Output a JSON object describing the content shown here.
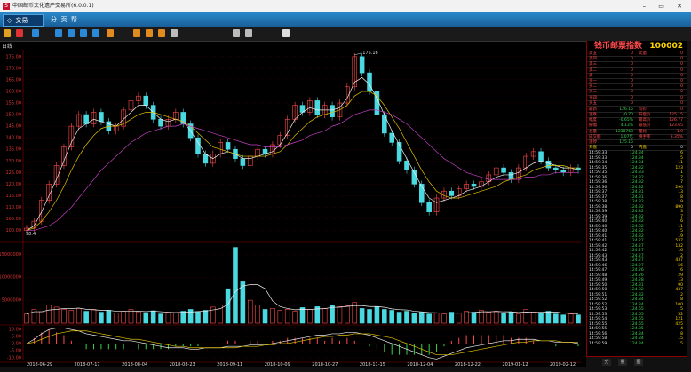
{
  "window": {
    "title": "中国邮币文化遗产交易所(6.0.0.1)",
    "logo": "S",
    "controls": "– ▭ ✕"
  },
  "menubar": {
    "trade_tab": "交易",
    "menu_items": [
      "分",
      "页",
      "帮"
    ]
  },
  "colors": {
    "up": "#ff4b4b",
    "down": "#38d24d",
    "accent": "#ffd700",
    "cyan": "#4ad9e0",
    "bg": "#000000"
  },
  "toolbar": {
    "icons": [
      "bar-chart-icon",
      "kline-icon",
      "minute-chart-icon",
      "fund-icon",
      "f10-icon",
      "f1-icon",
      "quote-icon",
      "ranking-icon",
      "f6-icon",
      "indicator-icon",
      "layout-icon",
      "draw-icon",
      "zoom-in-icon",
      "zoom-out-icon",
      "settings-icon"
    ]
  },
  "chart_data": {
    "type": "line",
    "period_label": "日线",
    "price_axis": {
      "ticks": [
        175,
        170,
        165,
        160,
        155,
        150,
        145,
        140,
        135,
        130,
        125,
        120,
        115,
        110,
        105,
        100
      ],
      "ylim": [
        96,
        178
      ]
    },
    "max_label": "175.16",
    "min_label": "98.4",
    "volume_axis": {
      "ticks": [
        15000000,
        10000000,
        5000000
      ],
      "tick_labels": [
        "15000000",
        "10000000",
        "5000000"
      ],
      "ylim": [
        0,
        17000000
      ]
    },
    "macd_axis": {
      "ticks": [
        10,
        5,
        0,
        -5,
        -10
      ],
      "tick_labels": [
        "10.00",
        "5.00",
        "0.00",
        "-5.00",
        "-10.00"
      ],
      "ylim": [
        -12,
        12
      ]
    },
    "date_labels": [
      "2018-06-29",
      "2018-07-17",
      "2018-08-04",
      "2018-08-23",
      "2018-09-11",
      "2018-10-09",
      "2018-10-27",
      "2018-11-15",
      "2018-12-04",
      "2018-12-22",
      "2019-01-12",
      "2019-02-12"
    ],
    "price_points": [
      101,
      104,
      113,
      120,
      128,
      136,
      145,
      150,
      146,
      151,
      147,
      143,
      145,
      152,
      156,
      158,
      154,
      148,
      145,
      148,
      151,
      146,
      140,
      133,
      129,
      133,
      138,
      135,
      131,
      128,
      132,
      135,
      133,
      137,
      141,
      148,
      154,
      151,
      156,
      150,
      154,
      149,
      155,
      162,
      175,
      168,
      160,
      150,
      142,
      138,
      130,
      126,
      120,
      112,
      108,
      114,
      117,
      115,
      118,
      120,
      119,
      121,
      124,
      127,
      125,
      122,
      127,
      132,
      134,
      130,
      127,
      126,
      125,
      127,
      126
    ],
    "ma5": [
      100,
      102,
      108,
      115,
      122,
      130,
      138,
      144,
      146,
      148,
      147,
      146,
      145,
      148,
      151,
      154,
      154,
      151,
      148,
      147,
      148,
      147,
      143,
      138,
      133,
      131,
      133,
      134,
      133,
      131,
      131,
      132,
      133,
      134,
      137,
      142,
      148,
      151,
      153,
      152,
      152,
      152,
      153,
      157,
      164,
      166,
      163,
      157,
      150,
      143,
      137,
      131,
      125,
      119,
      114,
      112,
      113,
      114,
      115,
      117,
      118,
      119,
      121,
      123,
      124,
      124,
      125,
      127,
      129,
      130,
      129,
      128,
      127,
      127,
      126
    ],
    "ma10": [
      100,
      101,
      104,
      108,
      113,
      119,
      126,
      132,
      137,
      141,
      144,
      145,
      145,
      146,
      148,
      150,
      151,
      151,
      150,
      149,
      148,
      147,
      145,
      142,
      139,
      136,
      135,
      134,
      133,
      132,
      132,
      132,
      132,
      133,
      134,
      137,
      141,
      144,
      147,
      149,
      150,
      151,
      152,
      154,
      158,
      160,
      160,
      158,
      154,
      149,
      144,
      138,
      132,
      126,
      121,
      117,
      115,
      114,
      114,
      115,
      116,
      117,
      118,
      119,
      121,
      122,
      123,
      124,
      126,
      127,
      128,
      128,
      128,
      127,
      127
    ],
    "ma30": [
      100,
      100,
      101,
      102,
      104,
      107,
      110,
      114,
      118,
      122,
      126,
      129,
      132,
      135,
      138,
      140,
      142,
      143,
      144,
      145,
      145,
      146,
      145,
      144,
      143,
      142,
      141,
      140,
      139,
      138,
      137,
      137,
      136,
      136,
      136,
      137,
      138,
      139,
      141,
      142,
      143,
      145,
      146,
      148,
      150,
      151,
      152,
      152,
      151,
      150,
      148,
      146,
      143,
      140,
      137,
      134,
      131,
      129,
      127,
      125,
      124,
      123,
      122,
      122,
      122,
      122,
      122,
      123,
      123,
      124,
      124,
      125,
      125,
      125,
      125
    ],
    "volume_points": [
      2000000,
      3000000,
      2500000,
      4000000,
      3500000,
      3000000,
      2800000,
      3200000,
      2600000,
      3000000,
      2400000,
      2800000,
      2200000,
      2600000,
      3000000,
      2500000,
      2300000,
      2700000,
      2000000,
      2400000,
      2200000,
      2600000,
      3000000,
      2500000,
      2800000,
      3500000,
      4000000,
      7500000,
      16500000,
      9000000,
      5000000,
      4000000,
      3000000,
      3200000,
      2800000,
      3000000,
      2600000,
      3400000,
      3000000,
      3600000,
      3200000,
      4000000,
      3600000,
      3800000,
      4500000,
      3200000,
      3000000,
      3600000,
      3000000,
      2800000,
      2400000,
      2600000,
      2200000,
      2400000,
      2000000,
      2200000,
      2000000,
      2400000,
      2200000,
      2600000,
      2400000,
      2800000,
      2400000,
      2600000,
      2200000,
      2400000,
      2000000,
      3000000,
      2400000,
      2200000,
      2600000,
      2000000,
      1800000,
      2000000,
      1800000
    ],
    "macd_dif": [
      0,
      3,
      7,
      10,
      11,
      11,
      10,
      9,
      7,
      6,
      5,
      4,
      3,
      2,
      2,
      1,
      0,
      -1,
      -2,
      -3,
      -3,
      -3,
      -4,
      -4,
      -3,
      -3,
      -3,
      -2,
      -2,
      -2,
      -1,
      -1,
      -1,
      0,
      1,
      2,
      3,
      4,
      5,
      6,
      6,
      7,
      7,
      8,
      8,
      7,
      6,
      4,
      2,
      0,
      -2,
      -4,
      -6,
      -8,
      -10,
      -11,
      -9,
      -7,
      -5,
      -3,
      -2,
      -1,
      0,
      1,
      2,
      2,
      3,
      3,
      3,
      2,
      2,
      1,
      1,
      1,
      0
    ],
    "macd_dea": [
      0,
      1,
      3,
      5,
      7,
      8,
      9,
      9,
      9,
      8,
      7,
      6,
      5,
      4,
      3,
      3,
      2,
      1,
      0,
      -1,
      -2,
      -2,
      -3,
      -3,
      -3,
      -3,
      -3,
      -3,
      -3,
      -2,
      -2,
      -2,
      -1,
      -1,
      0,
      0,
      1,
      2,
      3,
      4,
      5,
      5,
      6,
      6,
      7,
      7,
      7,
      6,
      5,
      4,
      2,
      0,
      -2,
      -4,
      -6,
      -8,
      -8,
      -8,
      -7,
      -6,
      -5,
      -4,
      -3,
      -2,
      -1,
      0,
      1,
      1,
      2,
      2,
      2,
      2,
      1,
      1,
      1
    ]
  },
  "quote_panel": {
    "title": "钱币邮票指数",
    "code": "100002",
    "order_book": [
      [
        "卖五",
        "0",
        "卖量",
        "0"
      ],
      [
        "卖四",
        "0",
        "",
        "0"
      ],
      [
        "卖三",
        "0",
        "",
        "0"
      ],
      [
        "卖二",
        "0",
        "",
        "0"
      ],
      [
        "卖一",
        "0",
        "",
        "0"
      ],
      [
        "买一",
        "0",
        "",
        "0"
      ],
      [
        "买二",
        "0",
        "",
        "0"
      ],
      [
        "买三",
        "0",
        "",
        "0"
      ],
      [
        "买四",
        "0",
        "",
        "0"
      ],
      [
        "买五",
        "0",
        "",
        "0"
      ]
    ],
    "stats": [
      [
        "最新",
        "126.15",
        "均价",
        "0"
      ],
      [
        "涨跌",
        "-0.70",
        "开盘价",
        "125.15"
      ],
      [
        "幅度",
        "-0.65%",
        "最高价",
        "126.77"
      ],
      [
        "振幅",
        "4.13%",
        "最低价",
        "123.65"
      ],
      [
        "总量",
        "1238763",
        "量比",
        "1.0"
      ],
      [
        "成交额",
        "1.07亿",
        "换手率",
        "3.35%"
      ],
      [
        "涨停",
        "125.15",
        "",
        ""
      ]
    ],
    "ticks_header": [
      "外盘",
      "0",
      "内盘",
      "0"
    ],
    "ticks": [
      [
        "14:59:33",
        "124.34",
        "6"
      ],
      [
        "14:59:33",
        "124.34",
        "5"
      ],
      [
        "14:59:34",
        "124.34",
        "11"
      ],
      [
        "14:59:35",
        "124.32",
        "123"
      ],
      [
        "14:59:35",
        "124.33",
        "1"
      ],
      [
        "14:59:36",
        "124.32",
        "7"
      ],
      [
        "14:59:36",
        "124.32",
        "7"
      ],
      [
        "14:59:36",
        "124.32",
        "290"
      ],
      [
        "14:59:37",
        "124.31",
        "13"
      ],
      [
        "14:59:37",
        "124.31",
        "8"
      ],
      [
        "14:59:38",
        "124.32",
        "19"
      ],
      [
        "14:59:38",
        "124.32",
        "890"
      ],
      [
        "14:59:39",
        "124.32",
        "3"
      ],
      [
        "14:59:39",
        "124.32",
        "7"
      ],
      [
        "14:59:40",
        "124.32",
        "6"
      ],
      [
        "14:59:40",
        "124.32",
        "11"
      ],
      [
        "14:59:40",
        "124.32",
        "5"
      ],
      [
        "14:59:41",
        "124.32",
        "19"
      ],
      [
        "14:59:41",
        "124.27",
        "537"
      ],
      [
        "14:59:42",
        "124.27",
        "132"
      ],
      [
        "14:59:42",
        "124.27",
        "16"
      ],
      [
        "14:59:43",
        "124.27",
        "2"
      ],
      [
        "14:59:43",
        "124.27",
        "437"
      ],
      [
        "14:59:46",
        "124.27",
        "56"
      ],
      [
        "14:59:47",
        "124.26",
        "6"
      ],
      [
        "14:59:48",
        "124.26",
        "29"
      ],
      [
        "14:59:49",
        "124.28",
        "13"
      ],
      [
        "14:59:50",
        "124.31",
        "90"
      ],
      [
        "14:59:50",
        "124.32",
        "437"
      ],
      [
        "14:59:51",
        "124.32",
        "2"
      ],
      [
        "14:59:52",
        "124.34",
        "8"
      ],
      [
        "14:59:52",
        "124.34",
        "100"
      ],
      [
        "14:59:53",
        "124.65",
        "5"
      ],
      [
        "14:59:53",
        "124.65",
        "52"
      ],
      [
        "14:59:54",
        "124.65",
        "121"
      ],
      [
        "14:59:55",
        "124.65",
        "425"
      ],
      [
        "14:59:55",
        "124.35",
        "4"
      ],
      [
        "14:59:56",
        "124.34",
        "8"
      ],
      [
        "14:59:58",
        "124.34",
        "15"
      ],
      [
        "14:59:59",
        "124.34",
        "5"
      ]
    ],
    "bottom_tabs": [
      "分",
      "量",
      "图"
    ]
  }
}
